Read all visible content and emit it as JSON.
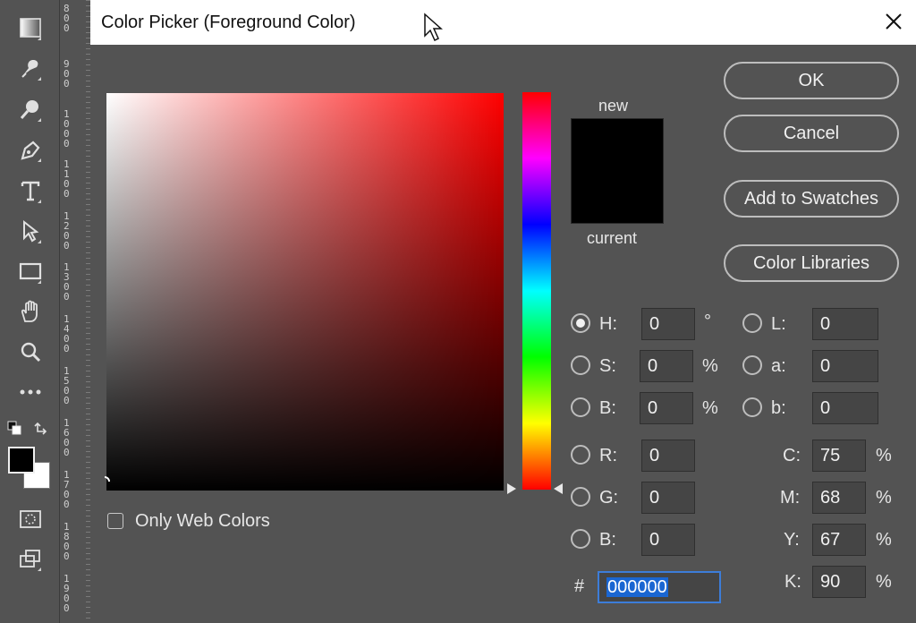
{
  "toolbar": {
    "tools": [
      {
        "name": "gradient-tool-icon"
      },
      {
        "name": "smudge-tool-icon"
      },
      {
        "name": "dodge-tool-icon"
      },
      {
        "name": "pen-tool-icon"
      },
      {
        "name": "type-tool-icon"
      },
      {
        "name": "path-selection-tool-icon"
      },
      {
        "name": "rectangle-tool-icon"
      },
      {
        "name": "hand-tool-icon"
      },
      {
        "name": "zoom-tool-icon"
      },
      {
        "name": "more-tools-icon"
      }
    ],
    "foreground_color": "#000000",
    "background_color": "#ffffff"
  },
  "ruler": {
    "labels": [
      "800",
      "900",
      "1000",
      "1100",
      "1200",
      "1300",
      "1400",
      "1500",
      "1600",
      "1700",
      "1800",
      "1900"
    ]
  },
  "dialog": {
    "title": "Color Picker (Foreground Color)",
    "preview": {
      "new_label": "new",
      "current_label": "current",
      "new_color": "#000000"
    },
    "buttons": {
      "ok": "OK",
      "cancel": "Cancel",
      "add_to_swatches": "Add to Swatches",
      "color_libraries": "Color Libraries"
    },
    "only_web_colors": {
      "label": "Only Web Colors",
      "checked": false
    },
    "hsb": {
      "h": {
        "label": "H:",
        "value": "0",
        "unit": "°",
        "selected": true
      },
      "s": {
        "label": "S:",
        "value": "0",
        "unit": "%"
      },
      "b": {
        "label": "B:",
        "value": "0",
        "unit": "%"
      }
    },
    "rgb": {
      "r": {
        "label": "R:",
        "value": "0"
      },
      "g": {
        "label": "G:",
        "value": "0"
      },
      "b": {
        "label": "B:",
        "value": "0"
      }
    },
    "lab": {
      "l": {
        "label": "L:",
        "value": "0"
      },
      "a": {
        "label": "a:",
        "value": "0"
      },
      "b": {
        "label": "b:",
        "value": "0"
      }
    },
    "cmyk": {
      "c": {
        "label": "C:",
        "value": "75",
        "unit": "%"
      },
      "m": {
        "label": "M:",
        "value": "68",
        "unit": "%"
      },
      "y": {
        "label": "Y:",
        "value": "67",
        "unit": "%"
      },
      "k": {
        "label": "K:",
        "value": "90",
        "unit": "%"
      }
    },
    "hex": {
      "hash": "#",
      "value": "000000"
    }
  }
}
